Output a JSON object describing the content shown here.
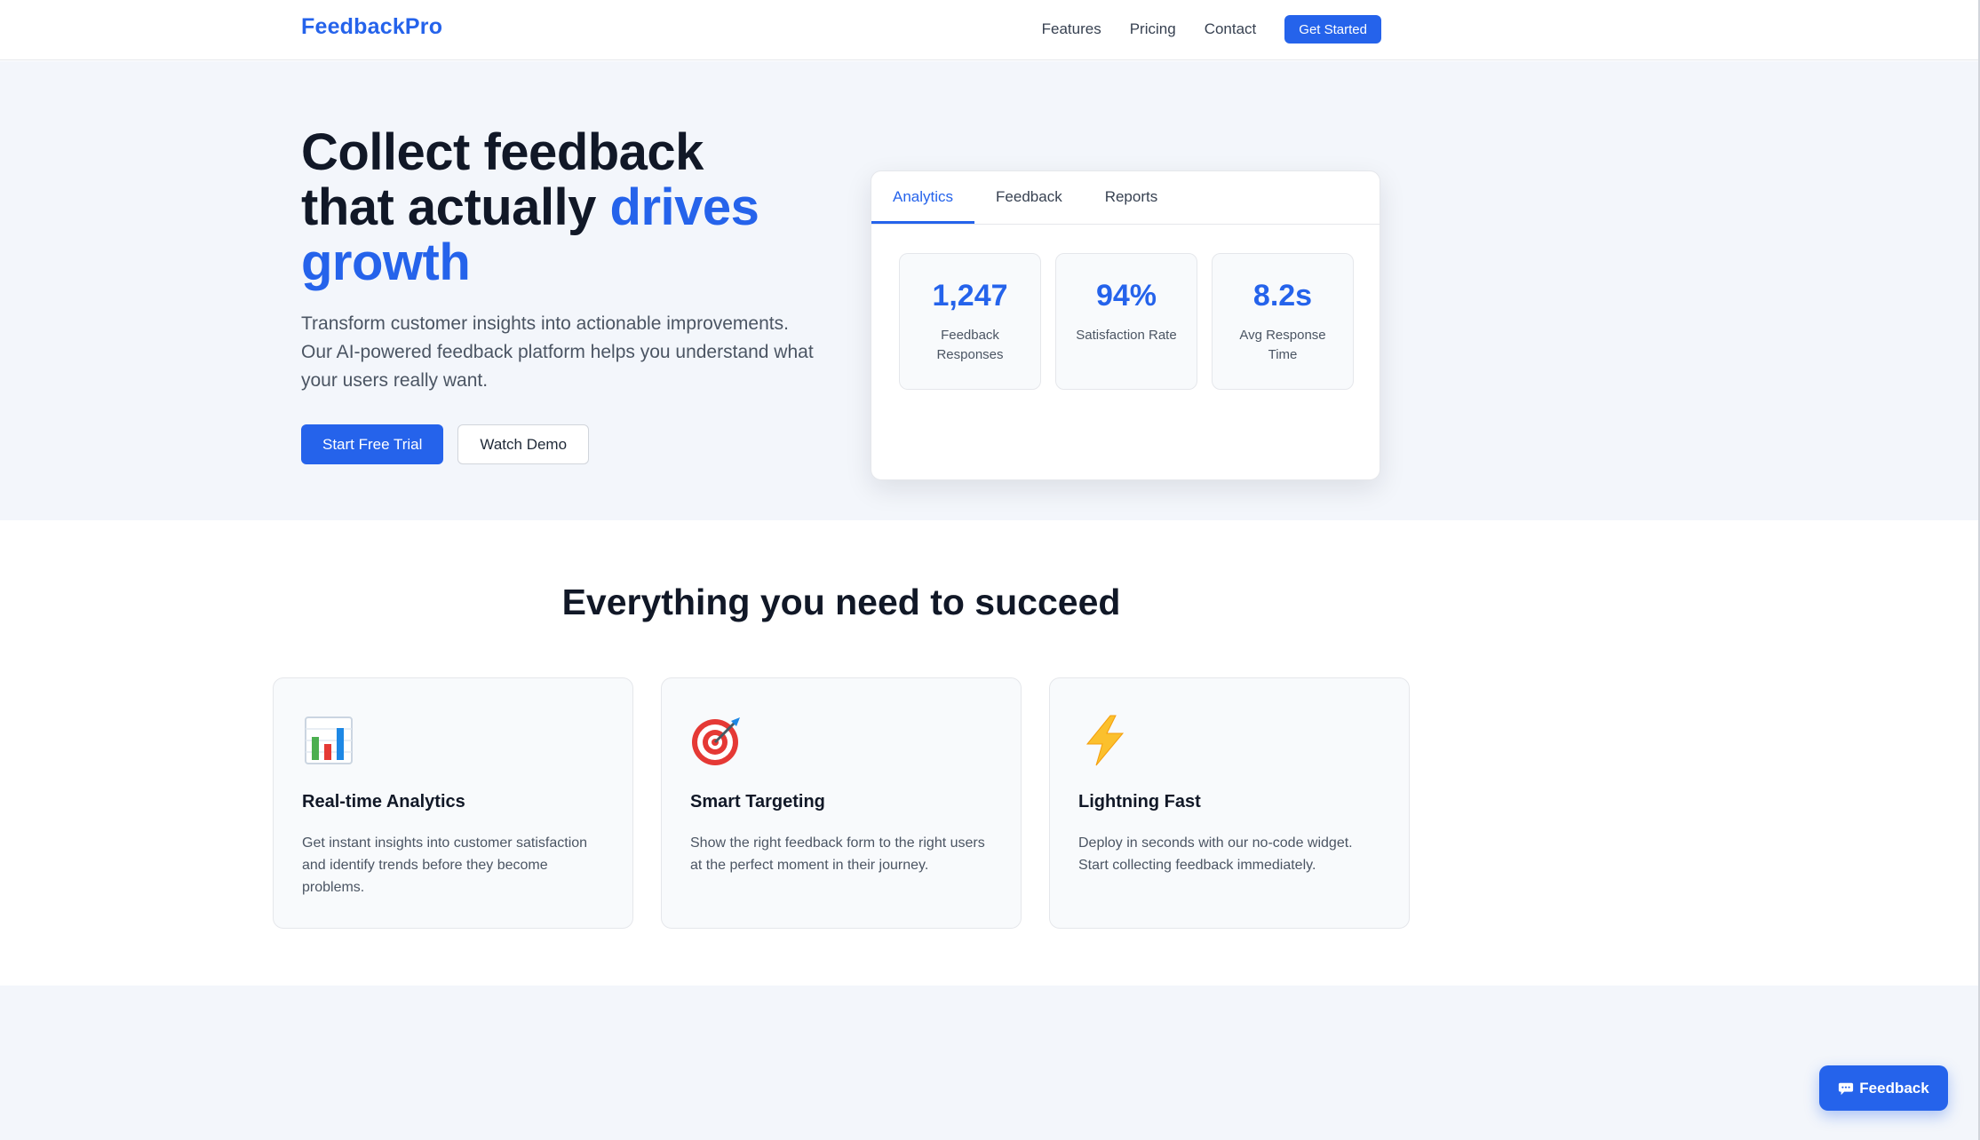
{
  "nav": {
    "brand": "FeedbackPro",
    "links": [
      "Features",
      "Pricing",
      "Contact"
    ],
    "cta": "Get Started"
  },
  "hero": {
    "title_line1": "Collect feedback",
    "title_line2_plain": "that actually ",
    "title_accent": "drives growth",
    "subtitle": "Transform customer insights into actionable improvements. Our AI-powered feedback platform helps you understand what your users really want.",
    "primary_button": "Start Free Trial",
    "secondary_button": "Watch Demo"
  },
  "dashboard": {
    "tabs": [
      "Analytics",
      "Feedback",
      "Reports"
    ],
    "active_tab": "Analytics",
    "stats": [
      {
        "value": "1,247",
        "label": "Feedback Responses"
      },
      {
        "value": "94%",
        "label": "Satisfaction Rate"
      },
      {
        "value": "8.2s",
        "label": "Avg Response Time"
      }
    ]
  },
  "features": {
    "title": "Everything you need to succeed",
    "cards": [
      {
        "icon": "bar-chart-icon",
        "title": "Real-time Analytics",
        "description": "Get instant insights into customer satisfaction and identify trends before they become problems."
      },
      {
        "icon": "target-icon",
        "title": "Smart Targeting",
        "description": "Show the right feedback form to the right users at the perfect moment in their journey."
      },
      {
        "icon": "lightning-icon",
        "title": "Lightning Fast",
        "description": "Deploy in seconds with our no-code widget. Start collecting feedback immediately."
      }
    ]
  },
  "feedback_widget": {
    "label": "Feedback",
    "icon": "speech-bubble-icon"
  },
  "colors": {
    "accent": "#2563eb",
    "hero_bg": "#f3f6fb",
    "heading": "#111827",
    "body_text": "#4b5563"
  }
}
